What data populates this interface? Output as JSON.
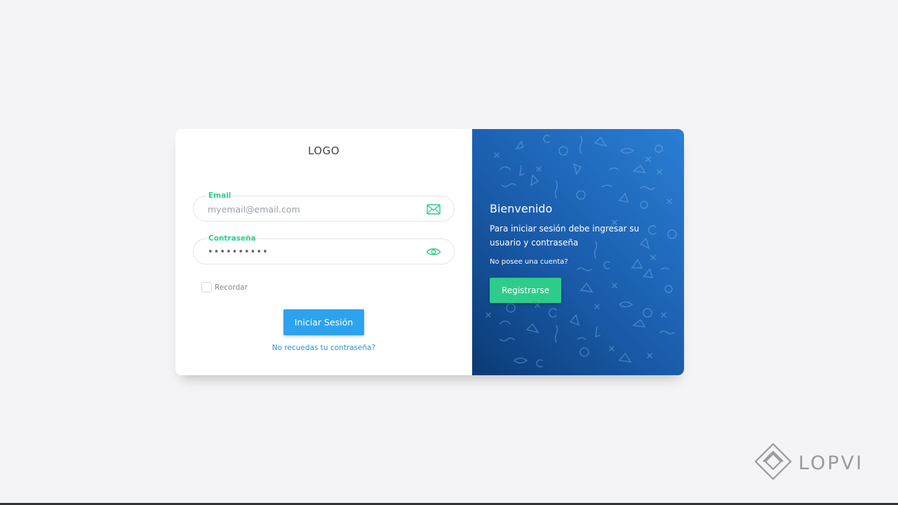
{
  "login": {
    "logo": "LOGO",
    "email_label": "Email",
    "email_placeholder": "myemail@email.com",
    "password_label": "Contraseña",
    "password_value": "••••••••••",
    "remember_label": "Recordar",
    "submit_label": "Iniciar Sesión",
    "forgot_link": "No recuedas tu contraseña?"
  },
  "welcome": {
    "title": "Bienvenido",
    "text": "Para iniciar sesión debe ingresar su usuario y contraseña",
    "no_account": "No posee una cuenta?",
    "register_label": "Registrarse"
  },
  "icons": {
    "email": "envelope-icon",
    "password": "eye-icon",
    "brand": "lopvi-logo-icon"
  },
  "brand": {
    "name": "LOPVI"
  },
  "colors": {
    "accent_green": "#2ecc8a",
    "accent_blue": "#2da3ef",
    "link_blue": "#2d8fd8",
    "panel_gradient_start": "#0b3a73",
    "panel_gradient_end": "#2a7fd4",
    "background": "#f4f4f6"
  }
}
